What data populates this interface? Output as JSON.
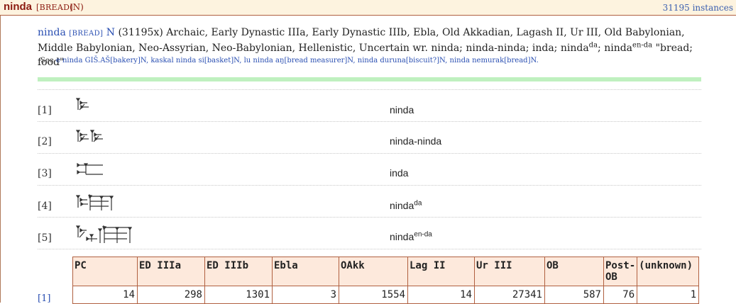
{
  "header": {
    "word": "ninda",
    "sense": "[BREAD]",
    "pos": "(N)",
    "instances": "31195 instances"
  },
  "entry": {
    "word": "ninda",
    "sense": "[BREAD]",
    "pos": "N",
    "count": "(31195x)",
    "periods": "Archaic, Early Dynastic IIIa, Early Dynastic IIIb, Ebla, Old Akkadian, Lagash II, Ur III, Old Babylonian, Middle Babylonian, Neo-Assyrian, Neo-Babylonian, Hellenistic, Uncertain",
    "wr_label": "wr.",
    "forms_text": "ninda; ninda-ninda; inda; ninda",
    "form_sup1": "da",
    "form_tail": "; ninda",
    "form_sup2": "en-da",
    "gloss": "\"bread; food\""
  },
  "see": {
    "label": "See",
    "links": [
      "e ninda GIŠ.AŠ[bakery]N",
      "kaskal ninda si[basket]N",
      "lu ninda aŋ[bread measurer]N",
      "ninda duruna[biscuit?]N",
      "ninda nemurak[bread]N."
    ]
  },
  "forms": [
    {
      "index": "[1]",
      "glyph": "ninda-cuneiform-icon",
      "text": "ninda",
      "sup": ""
    },
    {
      "index": "[2]",
      "glyph": "ninda-ninda-cuneiform-icon",
      "text": "ninda-ninda",
      "sup": ""
    },
    {
      "index": "[3]",
      "glyph": "inda-cuneiform-icon",
      "text": "inda",
      "sup": ""
    },
    {
      "index": "[4]",
      "glyph": "ninda-da-cuneiform-icon",
      "text": "ninda",
      "sup": "da"
    },
    {
      "index": "[5]",
      "glyph": "ninda-en-da-cuneiform-icon",
      "text": "ninda",
      "sup": "en-da"
    }
  ],
  "stats": {
    "headers": [
      "PC",
      "ED IIIa",
      "ED IIIb",
      "Ebla",
      "OAkk",
      "Lag II",
      "Ur III",
      "OB",
      "Post-OB",
      "(unknown)"
    ],
    "row_index": "[1]",
    "values": [
      "14",
      "298",
      "1301",
      "3",
      "1554",
      "14",
      "27341",
      "587",
      "76",
      "1"
    ]
  }
}
